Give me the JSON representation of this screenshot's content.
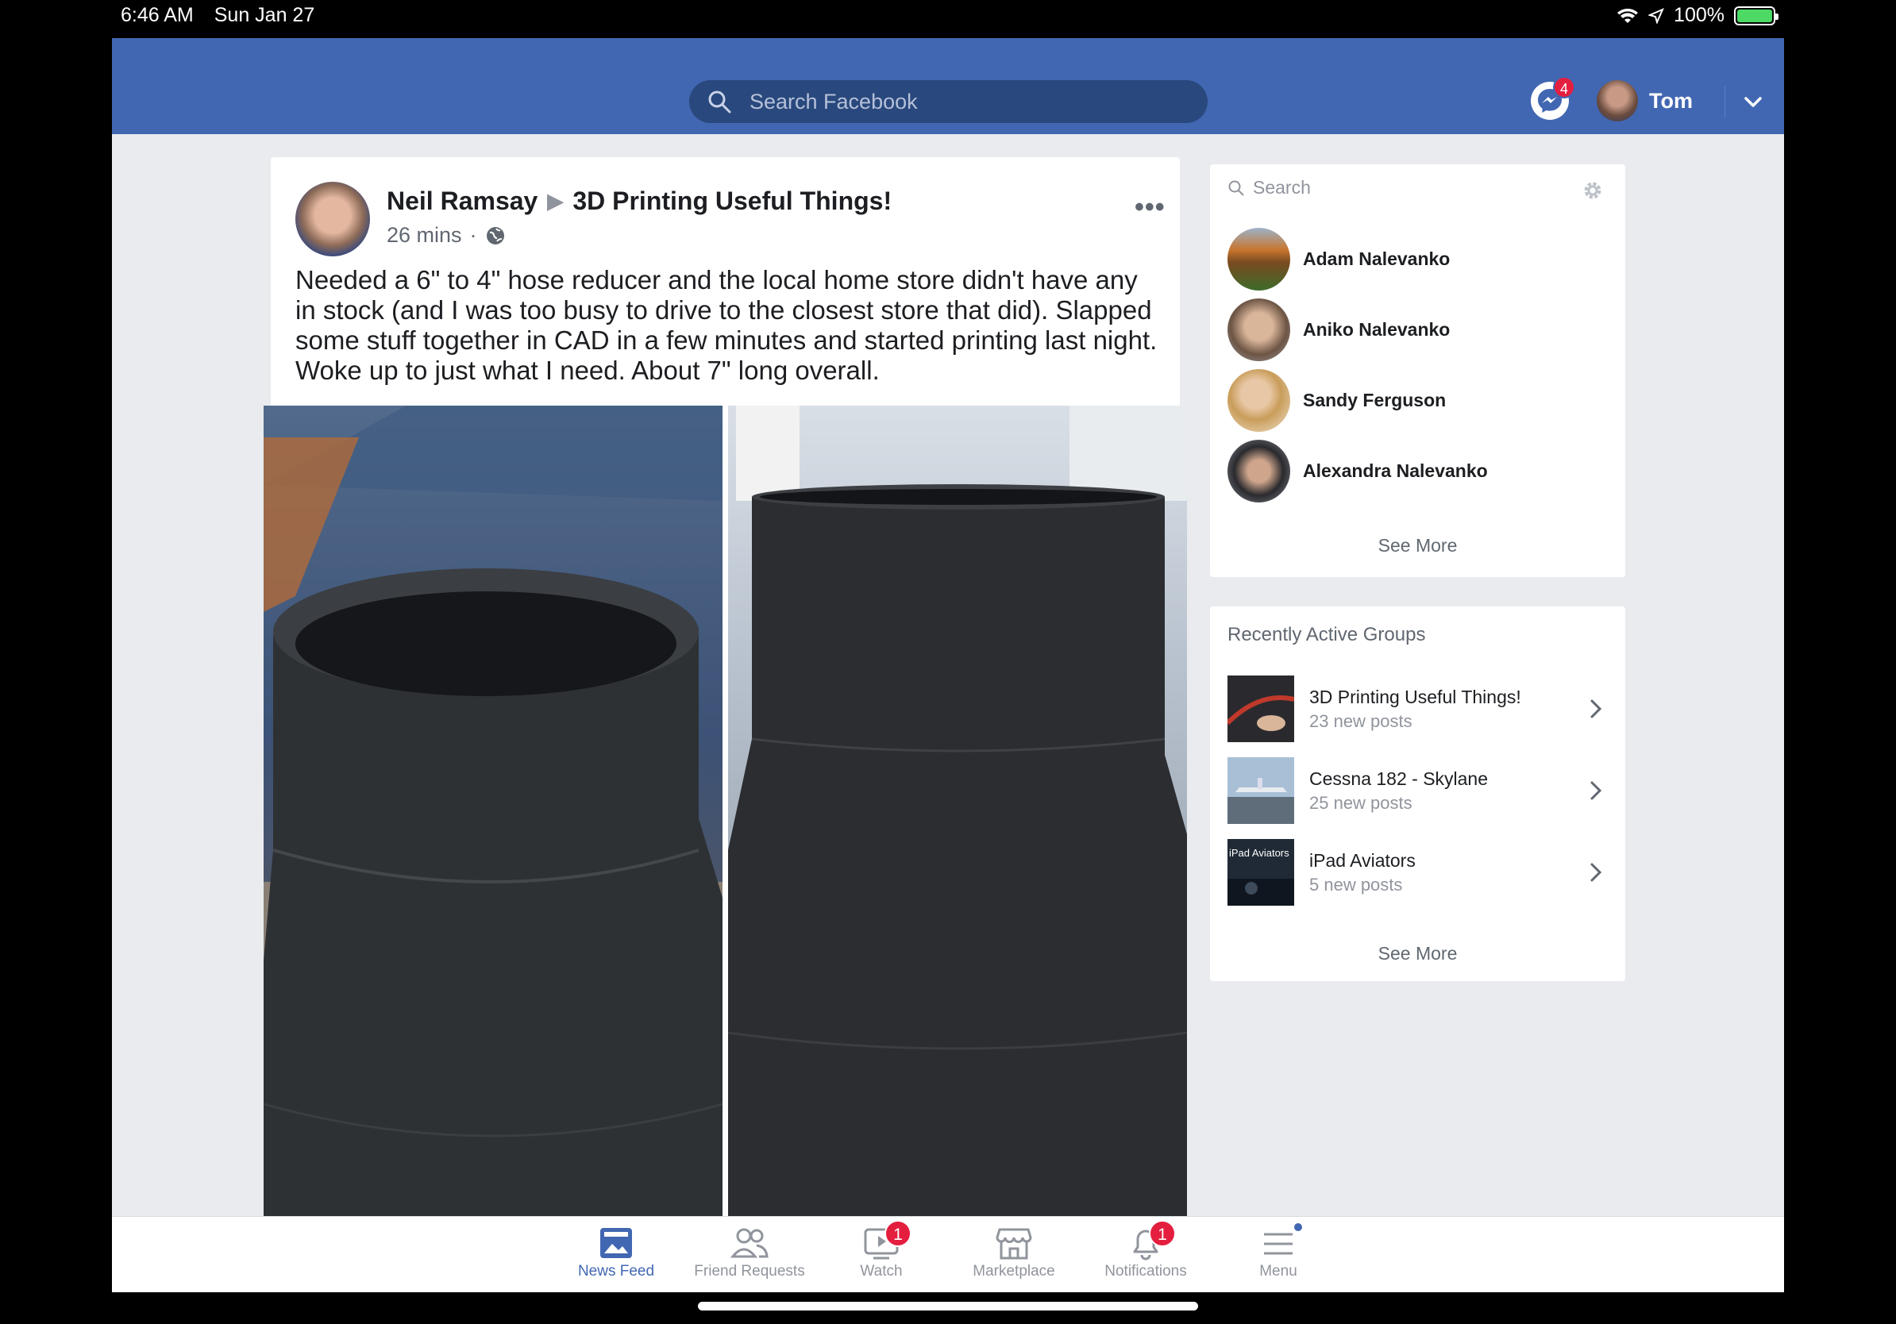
{
  "status_bar": {
    "time": "6:46 AM",
    "date": "Sun Jan 27",
    "battery": "100%"
  },
  "header": {
    "search_placeholder": "Search Facebook",
    "messenger_badge": "4",
    "user_name": "Tom",
    "brand_color": "#4267b2"
  },
  "post": {
    "author": "Neil Ramsay",
    "group": "3D Printing Useful Things!",
    "time": "26 mins",
    "privacy_icon": "globe-icon",
    "text": "Needed a 6\" to 4\" hose reducer and the local home store didn't have any in stock (and I was too busy to drive to the closest store that did). Slapped some stuff together in CAD in a few minutes and started printing last night. Woke up to just what I need. About 7\" long overall.",
    "more_label": "•••"
  },
  "contacts": {
    "search_placeholder": "Search",
    "items": [
      {
        "name": "Adam Nalevanko"
      },
      {
        "name": "Aniko Nalevanko"
      },
      {
        "name": "Sandy Ferguson"
      },
      {
        "name": "Alexandra Nalevanko"
      }
    ],
    "see_more": "See More"
  },
  "groups": {
    "title": "Recently Active Groups",
    "items": [
      {
        "name": "3D Printing Useful Things!",
        "sub": "23 new posts"
      },
      {
        "name": "Cessna 182 -  Skylane",
        "sub": "25 new posts"
      },
      {
        "name": "iPad Aviators",
        "sub": "5 new posts",
        "thumb_text": "iPad Aviators"
      }
    ],
    "see_more": "See More"
  },
  "tabs": [
    {
      "label": "News Feed",
      "icon": "news-feed-icon",
      "active": true
    },
    {
      "label": "Friend Requests",
      "icon": "friends-icon"
    },
    {
      "label": "Watch",
      "icon": "watch-icon",
      "badge": "1"
    },
    {
      "label": "Marketplace",
      "icon": "marketplace-icon"
    },
    {
      "label": "Notifications",
      "icon": "bell-icon",
      "badge": "1"
    },
    {
      "label": "Menu",
      "icon": "menu-icon"
    }
  ]
}
